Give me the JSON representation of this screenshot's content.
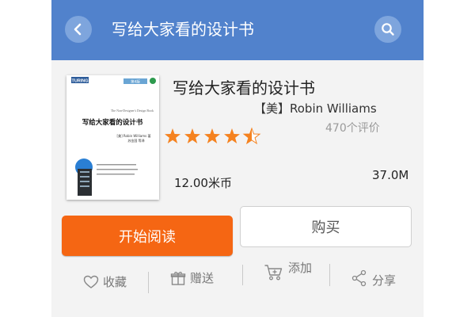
{
  "header": {
    "title": "写给大家看的设计书",
    "back_icon": "chevron-left-icon",
    "search_icon": "search-icon",
    "color": "#5182cc"
  },
  "book": {
    "title": "写给大家看的设计书",
    "author": "【美】Robin Williams",
    "rating": 4.5,
    "rating_max": 5,
    "rating_count": "470个评价",
    "price": "12.00米币",
    "size": "37.0M",
    "cover": {
      "publisher": "TURING",
      "title_cn": "写给大家看的设计书",
      "title_en": "The Non-Designer's Design Book",
      "edition": "第4版",
      "author_line": "[美] Robin Williams 著",
      "translator_line": "苏金国 等译"
    }
  },
  "buttons": {
    "read": "开始阅读",
    "buy": "购买",
    "read_color": "#f56613"
  },
  "actions": [
    {
      "label": "收藏",
      "icon": "heart-icon"
    },
    {
      "label": "赠送",
      "icon": "gift-icon"
    },
    {
      "label": "添加",
      "icon": "cart-add-icon"
    },
    {
      "label": "分享",
      "icon": "share-icon"
    }
  ],
  "colors": {
    "star": "#f5821f",
    "star_empty": "#cfcfcf"
  }
}
